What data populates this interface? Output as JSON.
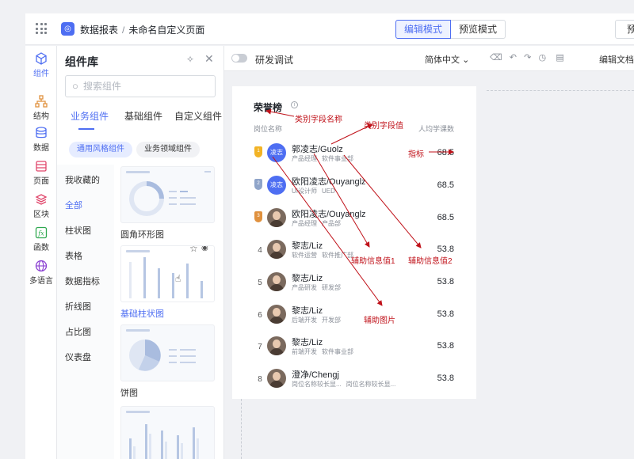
{
  "topbar": {
    "app_name": "数据报表",
    "separator": "/",
    "page_name": "未命名自定义页面",
    "mode_edit": "编辑模式",
    "mode_preview": "预览模式",
    "preview_btn": "预"
  },
  "rail": {
    "items": [
      {
        "label": "组件",
        "icon": "component-icon"
      },
      {
        "label": "结构",
        "icon": "structure-icon"
      },
      {
        "label": "数据",
        "icon": "database-icon"
      },
      {
        "label": "页面",
        "icon": "page-icon"
      },
      {
        "label": "区块",
        "icon": "block-icon"
      },
      {
        "label": "函数",
        "icon": "function-icon"
      },
      {
        "label": "多语言",
        "icon": "globe-icon"
      }
    ]
  },
  "panel": {
    "title": "组件库",
    "search_placeholder": "搜索组件",
    "tabs": [
      "业务组件",
      "基础组件",
      "自定义组件"
    ],
    "chips": [
      "通用风格组件",
      "业务领域组件"
    ],
    "categories": [
      "我收藏的",
      "全部",
      "柱状图",
      "表格",
      "数据指标",
      "折线图",
      "占比图",
      "仪表盘"
    ],
    "thumbnails": [
      "圆角环形图",
      "基础柱状图",
      "饼图"
    ]
  },
  "canvas": {
    "debug_label": "研发调试",
    "language": "简体中文",
    "doc_label": "编辑文档",
    "card": {
      "title": "荣誉榜",
      "col_left": "岗位名称",
      "col_right": "人均学课数",
      "rows": [
        {
          "rank": "",
          "avatar_text": "凌志",
          "name": "郭凌志/Guolz",
          "tag1": "产品经理",
          "tag2": "软件事业部",
          "value": "68.5"
        },
        {
          "rank": "",
          "avatar_text": "凌志",
          "name": "欧阳凌志/Ouyanglz",
          "tag1": "UI设计师",
          "tag2": "UED",
          "value": "68.5"
        },
        {
          "rank": "",
          "avatar_text": "",
          "name": "欧阳凌志/Ouyanglz",
          "tag1": "产品经理",
          "tag2": "产品部",
          "value": "68.5"
        },
        {
          "rank": "4",
          "avatar_text": "",
          "name": "黎志/Liz",
          "tag1": "软件运营",
          "tag2": "软件推广部",
          "value": "53.8"
        },
        {
          "rank": "5",
          "avatar_text": "",
          "name": "黎志/Liz",
          "tag1": "产品研发",
          "tag2": "研发部",
          "value": "53.8"
        },
        {
          "rank": "6",
          "avatar_text": "",
          "name": "黎志/Liz",
          "tag1": "后端开发",
          "tag2": "开发部",
          "value": "53.8"
        },
        {
          "rank": "7",
          "avatar_text": "",
          "name": "黎志/Liz",
          "tag1": "前端开发",
          "tag2": "软件事业部",
          "value": "53.8"
        },
        {
          "rank": "8",
          "avatar_text": "",
          "name": "澄净/Chengj",
          "tag1": "岗位名称较长显...",
          "tag2": "岗位名称较长显...",
          "value": "53.8"
        }
      ]
    }
  },
  "annotations": {
    "category_field_name": "类别字段名称",
    "category_field_value": "类别字段值",
    "metric": "指标",
    "aux_info_1": "辅助信息值1",
    "aux_info_2": "辅助信息值2",
    "aux_image": "辅助图片"
  },
  "colors": {
    "accent": "#4e6ef2",
    "annotation": "#c0121a",
    "gold": "#f2b325",
    "silver": "#8fa4c9",
    "bronze": "#e0913e"
  }
}
